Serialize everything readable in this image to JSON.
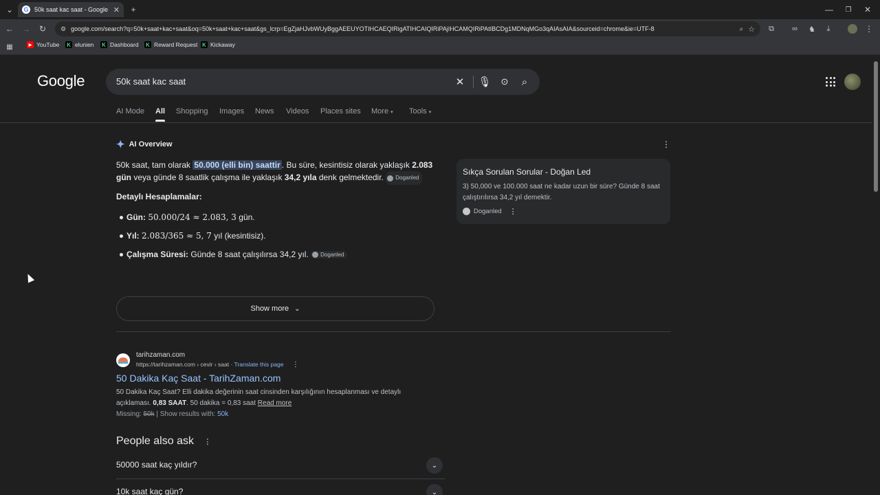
{
  "browser": {
    "tab_title": "50k saat kac saat - Google Search",
    "url": "google.com/search?q=50k+saat+kac+saat&oq=50k+saat+kac+saat&gs_lcrp=EgZjaHJvbWUyBggAEEUYOTIHCAEQIRigATIHCAIQIRiPAjIHCAMQIRiPAtIBCDg1MDNqMGo3qAIAsAIA&sourceid=chrome&ie=UTF-8",
    "bookmarks": [
      {
        "label": "YouTube",
        "icon": "youtube-icon",
        "color": "#ff0000"
      },
      {
        "label": "elunien",
        "icon": "k-icon",
        "color": "#3ddc84"
      },
      {
        "label": "Dashboard",
        "icon": "k-icon",
        "color": "#3ddc84"
      },
      {
        "label": "Reward Request",
        "icon": "k-icon",
        "color": "#3ddc84"
      },
      {
        "label": "Kickaway",
        "icon": "k-icon",
        "color": "#3ddc84"
      }
    ]
  },
  "google": {
    "logo": "Google",
    "query": "50k saat kac saat",
    "tabs": [
      "AI Mode",
      "All",
      "Shopping",
      "Images",
      "News",
      "Videos",
      "Places sites",
      "More",
      "Tools"
    ],
    "active_tab": "All"
  },
  "ai_overview": {
    "heading": "AI Overview",
    "p_a": "50k saat, tam olarak ",
    "p_hl": "50.000 (elli bin) saattir",
    "p_b": ". Bu süre, kesintisiz olarak yaklaşık ",
    "p_b1": "2.083 gün",
    "p_c": " veya günde 8 saatlik çalışma ile yaklaşık ",
    "p_b2": "34,2 yıla",
    "p_d": " denk gelmektedir.",
    "chip": "Doganled",
    "section": "Detaylı Hesaplamalar:",
    "bullets": [
      {
        "label": "Gün:",
        "math": "50.000/24 ≈ 2.083, 3",
        "rest": " gün."
      },
      {
        "label": "Yıl:",
        "math": "2.083/365 ≈ 5, 7",
        "rest": " yıl (kesintisiz)."
      },
      {
        "label": "Çalışma Süresi:",
        "math": "",
        "rest": " Günde 8 saat çalışılırsa 34,2 yıl."
      }
    ],
    "show_more": "Show more",
    "card": {
      "title": "Sıkça Sorulan Sorular - Doğan Led",
      "snippet": "3) 50,000 ve 100.000 saat ne kadar uzun bir süre? Günde 8 saat çalıştırılırsa 34,2 yıl demektir.",
      "source": "Doganled"
    }
  },
  "result": {
    "site": "tarihzaman.com",
    "crumb": "https://tarihzaman.com › cevir › saat",
    "translate": "Translate this page",
    "title": "50 Dakika Kaç Saat - TarihZaman.com",
    "snippet_a": "50 Dakika Kaç Saat? Elli dakika değerinin saat cinsinden karşılığının hesaplanması ve detaylı açıklaması.",
    "snippet_b": "0,83 SAAT",
    "snippet_c": ". 50 dakika = 0,83 saat",
    "read_more": "Read more",
    "missing_label": "Missing:",
    "missing_term": "50k",
    "show_with": "| Show results with:",
    "show_with_term": "50k"
  },
  "paa": {
    "title": "People also ask",
    "items": [
      "50000 saat kaç yıldır?",
      "10k saat kaç gün?"
    ]
  },
  "colors": {
    "accent": "#8ab4f8",
    "highlight": "#394457",
    "bg": "#1f1f1f"
  }
}
